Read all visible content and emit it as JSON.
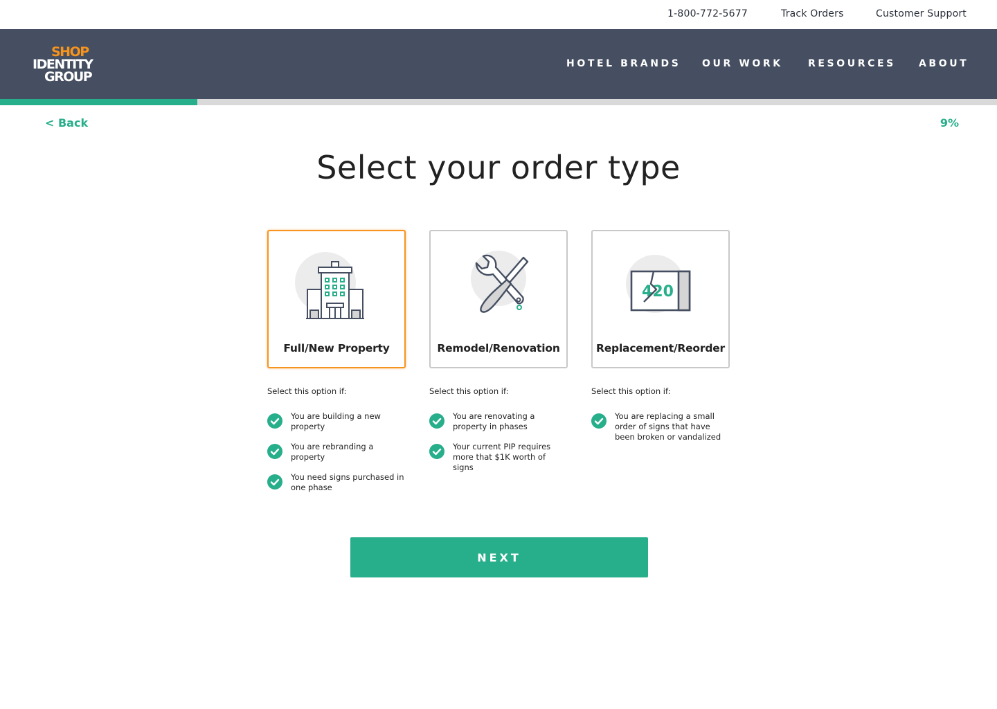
{
  "utility": {
    "phone": "1-800-772-5677",
    "track_orders": "Track Orders",
    "support": "Customer Support"
  },
  "brand": {
    "logo_line1": "SHOP",
    "logo_line2": "IDENTITY",
    "logo_line3": "GROUP",
    "logo_icon": "shop-identity-group-logo",
    "accent_color": "#f7941d",
    "header_color": "#454f61",
    "primary_color": "#27ae8a"
  },
  "nav": {
    "items": [
      {
        "label": "HOTEL BRANDS"
      },
      {
        "label": "OUR WORK"
      },
      {
        "label": "RESOURCES"
      },
      {
        "label": "ABOUT"
      }
    ]
  },
  "progress": {
    "back_label": "< Back",
    "percent_label": "9%",
    "fraction": 0.198
  },
  "page": {
    "title": "Select your order type"
  },
  "options": [
    {
      "label": "Full/New Property",
      "icon": "building-icon",
      "selected": true,
      "criteria_heading": "Select this option if:",
      "criteria": [
        "You are building a new property",
        "You are rebranding a property",
        "You need signs purchased in one phase"
      ]
    },
    {
      "label": "Remodel/Renovation",
      "icon": "tools-icon",
      "selected": false,
      "criteria_heading": "Select this option if:",
      "criteria": [
        "You are renovating a property in phases",
        "Your current PIP requires more that $1K worth of signs"
      ]
    },
    {
      "label": "Replacement/Reorder",
      "icon": "broken-sign-icon",
      "sign_number": "420",
      "selected": false,
      "criteria_heading": "Select this option if:",
      "criteria": [
        "You are replacing a small order of signs that have been broken or vandalized"
      ]
    }
  ],
  "actions": {
    "next_label": "NEXT"
  }
}
